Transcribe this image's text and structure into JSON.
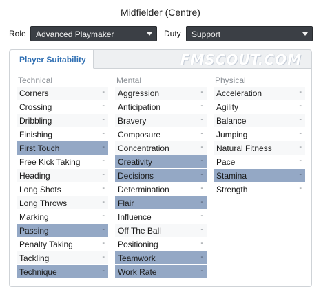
{
  "title": "Midfielder (Centre)",
  "role": {
    "label": "Role",
    "value": "Advanced Playmaker"
  },
  "duty": {
    "label": "Duty",
    "value": "Support"
  },
  "tab": {
    "label": "Player Suitability"
  },
  "watermark": "FMSCOUT.COM",
  "columns": {
    "technical": {
      "header": "Technical",
      "items": [
        {
          "name": "Corners",
          "value": "-",
          "highlight": false
        },
        {
          "name": "Crossing",
          "value": "-",
          "highlight": false
        },
        {
          "name": "Dribbling",
          "value": "-",
          "highlight": false
        },
        {
          "name": "Finishing",
          "value": "-",
          "highlight": false
        },
        {
          "name": "First Touch",
          "value": "-",
          "highlight": true
        },
        {
          "name": "Free Kick Taking",
          "value": "-",
          "highlight": false
        },
        {
          "name": "Heading",
          "value": "-",
          "highlight": false
        },
        {
          "name": "Long Shots",
          "value": "-",
          "highlight": false
        },
        {
          "name": "Long Throws",
          "value": "-",
          "highlight": false
        },
        {
          "name": "Marking",
          "value": "-",
          "highlight": false
        },
        {
          "name": "Passing",
          "value": "-",
          "highlight": true
        },
        {
          "name": "Penalty Taking",
          "value": "-",
          "highlight": false
        },
        {
          "name": "Tackling",
          "value": "-",
          "highlight": false
        },
        {
          "name": "Technique",
          "value": "-",
          "highlight": true
        }
      ]
    },
    "mental": {
      "header": "Mental",
      "items": [
        {
          "name": "Aggression",
          "value": "-",
          "highlight": false
        },
        {
          "name": "Anticipation",
          "value": "-",
          "highlight": false
        },
        {
          "name": "Bravery",
          "value": "-",
          "highlight": false
        },
        {
          "name": "Composure",
          "value": "-",
          "highlight": false
        },
        {
          "name": "Concentration",
          "value": "-",
          "highlight": false
        },
        {
          "name": "Creativity",
          "value": "-",
          "highlight": true
        },
        {
          "name": "Decisions",
          "value": "-",
          "highlight": true
        },
        {
          "name": "Determination",
          "value": "-",
          "highlight": false
        },
        {
          "name": "Flair",
          "value": "-",
          "highlight": true
        },
        {
          "name": "Influence",
          "value": "-",
          "highlight": false
        },
        {
          "name": "Off The Ball",
          "value": "-",
          "highlight": false
        },
        {
          "name": "Positioning",
          "value": "-",
          "highlight": false
        },
        {
          "name": "Teamwork",
          "value": "-",
          "highlight": true
        },
        {
          "name": "Work Rate",
          "value": "-",
          "highlight": true
        }
      ]
    },
    "physical": {
      "header": "Physical",
      "items": [
        {
          "name": "Acceleration",
          "value": "-",
          "highlight": false
        },
        {
          "name": "Agility",
          "value": "-",
          "highlight": false
        },
        {
          "name": "Balance",
          "value": "-",
          "highlight": false
        },
        {
          "name": "Jumping",
          "value": "-",
          "highlight": false
        },
        {
          "name": "Natural Fitness",
          "value": "-",
          "highlight": false
        },
        {
          "name": "Pace",
          "value": "-",
          "highlight": false
        },
        {
          "name": "Stamina",
          "value": "-",
          "highlight": true
        },
        {
          "name": "Strength",
          "value": "-",
          "highlight": false
        }
      ]
    }
  },
  "colors": {
    "highlight": "#94a8c5",
    "tab_text": "#2f6fb3",
    "select_bg": "#3b3f45"
  }
}
